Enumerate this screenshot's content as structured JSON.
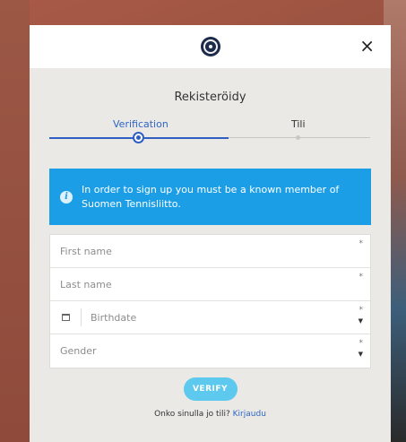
{
  "modal": {
    "title": "Rekisteröidy",
    "close_label": "×"
  },
  "stepper": {
    "steps": [
      {
        "label": "Verification",
        "active": true
      },
      {
        "label": "Tili",
        "active": false
      }
    ]
  },
  "info": {
    "icon": "i",
    "text": "In order to sign up you must be a known member of Suomen Tennisliitto."
  },
  "form": {
    "first_name_placeholder": "First name",
    "last_name_placeholder": "Last name",
    "birthdate_placeholder": "Birthdate",
    "gender_placeholder": "Gender",
    "required_marker": "*",
    "caret": "▲▼"
  },
  "actions": {
    "verify_label": "VERIFY",
    "login_prompt": "Onko sinulla jo tili?",
    "login_link": "Kirjaudu"
  },
  "colors": {
    "accent": "#2f66c5",
    "info_bg": "#1b9ee6",
    "verify_bg": "#5ec9ee"
  }
}
